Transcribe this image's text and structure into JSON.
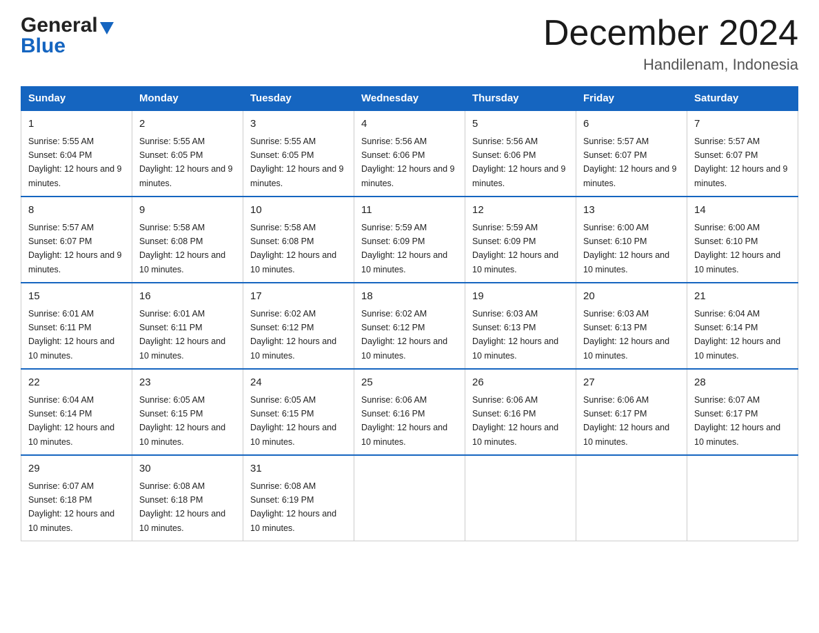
{
  "logo": {
    "general": "General",
    "blue": "Blue",
    "triangle": "▼"
  },
  "title": "December 2024",
  "subtitle": "Handilenam, Indonesia",
  "headers": [
    "Sunday",
    "Monday",
    "Tuesday",
    "Wednesday",
    "Thursday",
    "Friday",
    "Saturday"
  ],
  "weeks": [
    [
      {
        "day": "1",
        "sunrise": "5:55 AM",
        "sunset": "6:04 PM",
        "daylight": "12 hours and 9 minutes."
      },
      {
        "day": "2",
        "sunrise": "5:55 AM",
        "sunset": "6:05 PM",
        "daylight": "12 hours and 9 minutes."
      },
      {
        "day": "3",
        "sunrise": "5:55 AM",
        "sunset": "6:05 PM",
        "daylight": "12 hours and 9 minutes."
      },
      {
        "day": "4",
        "sunrise": "5:56 AM",
        "sunset": "6:06 PM",
        "daylight": "12 hours and 9 minutes."
      },
      {
        "day": "5",
        "sunrise": "5:56 AM",
        "sunset": "6:06 PM",
        "daylight": "12 hours and 9 minutes."
      },
      {
        "day": "6",
        "sunrise": "5:57 AM",
        "sunset": "6:07 PM",
        "daylight": "12 hours and 9 minutes."
      },
      {
        "day": "7",
        "sunrise": "5:57 AM",
        "sunset": "6:07 PM",
        "daylight": "12 hours and 9 minutes."
      }
    ],
    [
      {
        "day": "8",
        "sunrise": "5:57 AM",
        "sunset": "6:07 PM",
        "daylight": "12 hours and 9 minutes."
      },
      {
        "day": "9",
        "sunrise": "5:58 AM",
        "sunset": "6:08 PM",
        "daylight": "12 hours and 10 minutes."
      },
      {
        "day": "10",
        "sunrise": "5:58 AM",
        "sunset": "6:08 PM",
        "daylight": "12 hours and 10 minutes."
      },
      {
        "day": "11",
        "sunrise": "5:59 AM",
        "sunset": "6:09 PM",
        "daylight": "12 hours and 10 minutes."
      },
      {
        "day": "12",
        "sunrise": "5:59 AM",
        "sunset": "6:09 PM",
        "daylight": "12 hours and 10 minutes."
      },
      {
        "day": "13",
        "sunrise": "6:00 AM",
        "sunset": "6:10 PM",
        "daylight": "12 hours and 10 minutes."
      },
      {
        "day": "14",
        "sunrise": "6:00 AM",
        "sunset": "6:10 PM",
        "daylight": "12 hours and 10 minutes."
      }
    ],
    [
      {
        "day": "15",
        "sunrise": "6:01 AM",
        "sunset": "6:11 PM",
        "daylight": "12 hours and 10 minutes."
      },
      {
        "day": "16",
        "sunrise": "6:01 AM",
        "sunset": "6:11 PM",
        "daylight": "12 hours and 10 minutes."
      },
      {
        "day": "17",
        "sunrise": "6:02 AM",
        "sunset": "6:12 PM",
        "daylight": "12 hours and 10 minutes."
      },
      {
        "day": "18",
        "sunrise": "6:02 AM",
        "sunset": "6:12 PM",
        "daylight": "12 hours and 10 minutes."
      },
      {
        "day": "19",
        "sunrise": "6:03 AM",
        "sunset": "6:13 PM",
        "daylight": "12 hours and 10 minutes."
      },
      {
        "day": "20",
        "sunrise": "6:03 AM",
        "sunset": "6:13 PM",
        "daylight": "12 hours and 10 minutes."
      },
      {
        "day": "21",
        "sunrise": "6:04 AM",
        "sunset": "6:14 PM",
        "daylight": "12 hours and 10 minutes."
      }
    ],
    [
      {
        "day": "22",
        "sunrise": "6:04 AM",
        "sunset": "6:14 PM",
        "daylight": "12 hours and 10 minutes."
      },
      {
        "day": "23",
        "sunrise": "6:05 AM",
        "sunset": "6:15 PM",
        "daylight": "12 hours and 10 minutes."
      },
      {
        "day": "24",
        "sunrise": "6:05 AM",
        "sunset": "6:15 PM",
        "daylight": "12 hours and 10 minutes."
      },
      {
        "day": "25",
        "sunrise": "6:06 AM",
        "sunset": "6:16 PM",
        "daylight": "12 hours and 10 minutes."
      },
      {
        "day": "26",
        "sunrise": "6:06 AM",
        "sunset": "6:16 PM",
        "daylight": "12 hours and 10 minutes."
      },
      {
        "day": "27",
        "sunrise": "6:06 AM",
        "sunset": "6:17 PM",
        "daylight": "12 hours and 10 minutes."
      },
      {
        "day": "28",
        "sunrise": "6:07 AM",
        "sunset": "6:17 PM",
        "daylight": "12 hours and 10 minutes."
      }
    ],
    [
      {
        "day": "29",
        "sunrise": "6:07 AM",
        "sunset": "6:18 PM",
        "daylight": "12 hours and 10 minutes."
      },
      {
        "day": "30",
        "sunrise": "6:08 AM",
        "sunset": "6:18 PM",
        "daylight": "12 hours and 10 minutes."
      },
      {
        "day": "31",
        "sunrise": "6:08 AM",
        "sunset": "6:19 PM",
        "daylight": "12 hours and 10 minutes."
      },
      null,
      null,
      null,
      null
    ]
  ]
}
